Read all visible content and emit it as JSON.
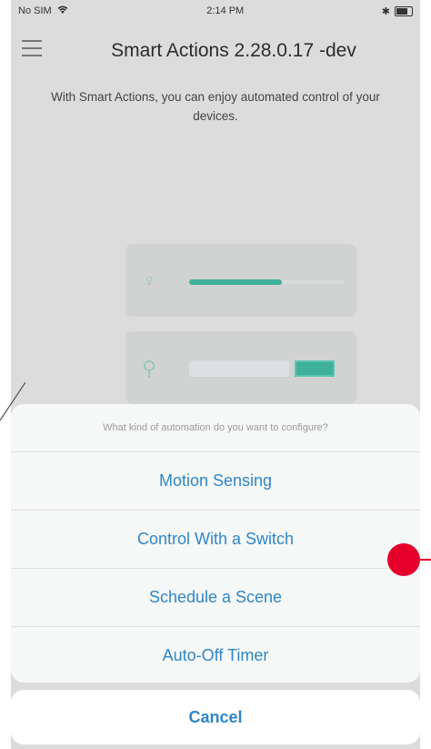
{
  "status_bar": {
    "carrier": "No SIM",
    "time": "2:14 PM"
  },
  "nav": {
    "title": "Smart Actions 2.28.0.17 -dev",
    "menu_icon": "hamburger-icon"
  },
  "description": "With Smart Actions, you can enjoy automated control of your devices.",
  "action_sheet": {
    "prompt": "What kind of automation do you want to configure?",
    "options": [
      {
        "label": "Motion Sensing"
      },
      {
        "label": "Control With a Switch"
      },
      {
        "label": "Schedule a Scene"
      },
      {
        "label": "Auto-Off Timer"
      }
    ],
    "cancel_label": "Cancel"
  },
  "colors": {
    "accent": "#2f86c9",
    "brand_teal": "#3fb09a",
    "marker_red": "#e4002b"
  }
}
